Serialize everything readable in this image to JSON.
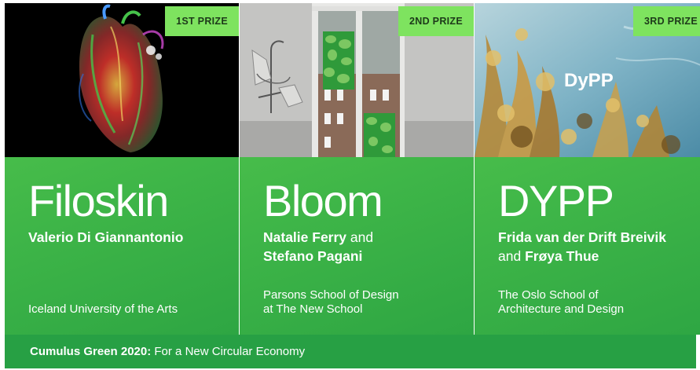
{
  "cards": [
    {
      "prize": "1ST PRIZE",
      "title": "Filoskin",
      "name1": "Valerio Di Giannantonio",
      "school": "Iceland University of the Arts",
      "image_icon": "heart-scan-image"
    },
    {
      "prize": "2ND PRIZE",
      "title": "Bloom",
      "name1": "Natalie Ferry",
      "conj": " and ",
      "name2": "Stefano Pagani",
      "school_line1": "Parsons School of Design",
      "school_line2": "at The New School",
      "image_icon": "window-room-image"
    },
    {
      "prize": "3RD PRIZE",
      "title": "DYPP",
      "name1": "Frida van der Drift Breivik",
      "conj_line": "and ",
      "name2": "Frøya Thue",
      "school_line1": "The Oslo School of",
      "school_line2": "Architecture and Design",
      "logo_text": "DyPP",
      "image_icon": "seaweed-underwater-image"
    }
  ],
  "footer": {
    "bold": "Cumulus Green 2020:",
    "rest": " For a New Circular Economy"
  },
  "colors": {
    "card_green": "#3fb648",
    "badge_green": "#7ee35f",
    "footer_green": "#27a044"
  }
}
